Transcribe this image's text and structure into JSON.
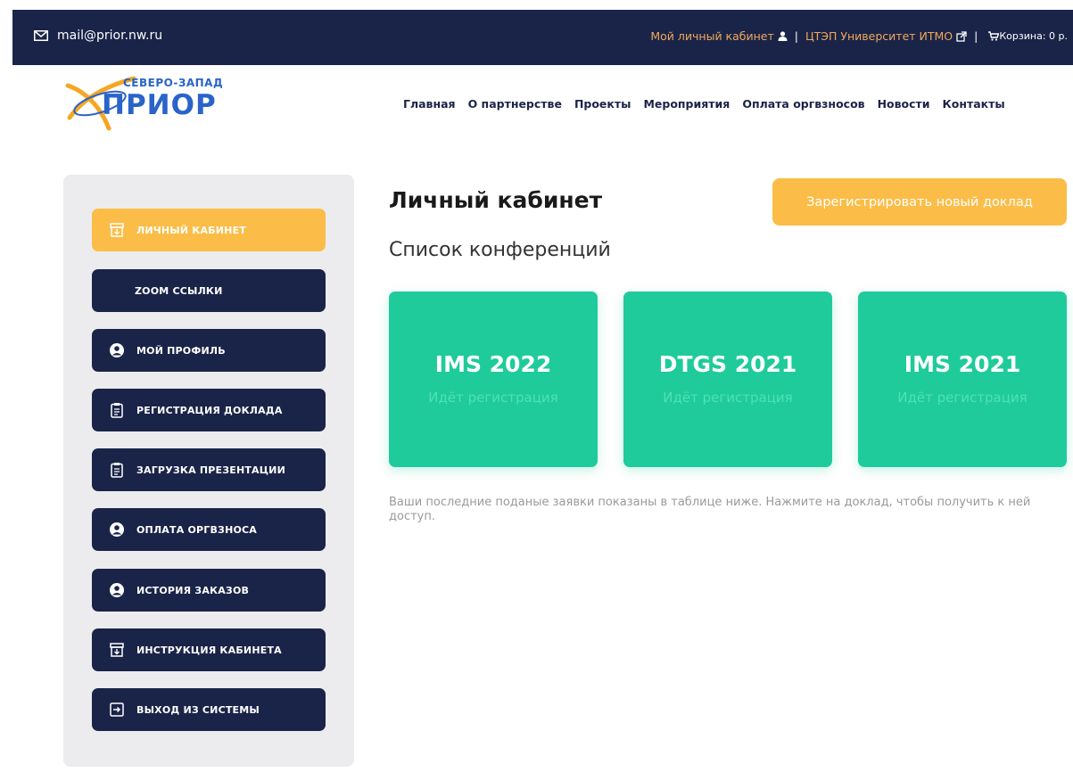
{
  "topbar": {
    "email": "mail@prior.nw.ru",
    "cabinet_link": "Мой личный кабинет",
    "separator": "|",
    "itmo_link": "ЦТЭП Университет ИТМО",
    "cart": "Корзина: 0 р."
  },
  "logo": {
    "sub": "СЕВЕРО-ЗАПАД",
    "main": "ПРИОР"
  },
  "nav": [
    "Главная",
    "О партнерстве",
    "Проекты",
    "Мероприятия",
    "Оплата оргвзносов",
    "Новости",
    "Контакты"
  ],
  "sidebar": {
    "items": [
      {
        "label": "ЛИЧНЫЙ КАБИНЕТ",
        "icon": "archive-icon"
      },
      {
        "label": "ZOOM ССЫЛКИ",
        "icon": ""
      },
      {
        "label": "МОЙ ПРОФИЛЬ",
        "icon": "user-circle-icon"
      },
      {
        "label": "РЕГИСТРАЦИЯ ДОКЛАДА",
        "icon": "clipboard-icon"
      },
      {
        "label": "ЗАГРУЗКА ПРЕЗЕНТАЦИИ",
        "icon": "clipboard-icon"
      },
      {
        "label": "ОПЛАТА ОРГВЗНОСА",
        "icon": "user-circle-icon"
      },
      {
        "label": "ИСТОРИЯ ЗАКАЗОВ",
        "icon": "user-circle-icon"
      },
      {
        "label": "ИНСТРУКЦИЯ КАБИНЕТА",
        "icon": "archive-icon"
      },
      {
        "label": "ВЫХОД ИЗ СИСТЕМЫ",
        "icon": "sign-out-icon"
      }
    ]
  },
  "main": {
    "title": "Личный кабинет",
    "subtitle": "Список конференций",
    "register_button": "Зарегистрировать новый доклад",
    "cards": [
      {
        "name": "IMS 2022",
        "status": "Идёт регистрация"
      },
      {
        "name": "DTGS 2021",
        "status": "Идёт регистрация"
      },
      {
        "name": "IMS 2021",
        "status": "Идёт регистрация"
      }
    ],
    "note": "Ваши последние поданые заявки показаны в таблице ниже. Нажмите на доклад, чтобы получить к ней доступ."
  },
  "colors": {
    "navy": "#1a2448",
    "accent": "#fbbd47",
    "card": "#1fcb9a",
    "link_orange": "#f0a85a",
    "logo_blue": "#2a63c9"
  }
}
